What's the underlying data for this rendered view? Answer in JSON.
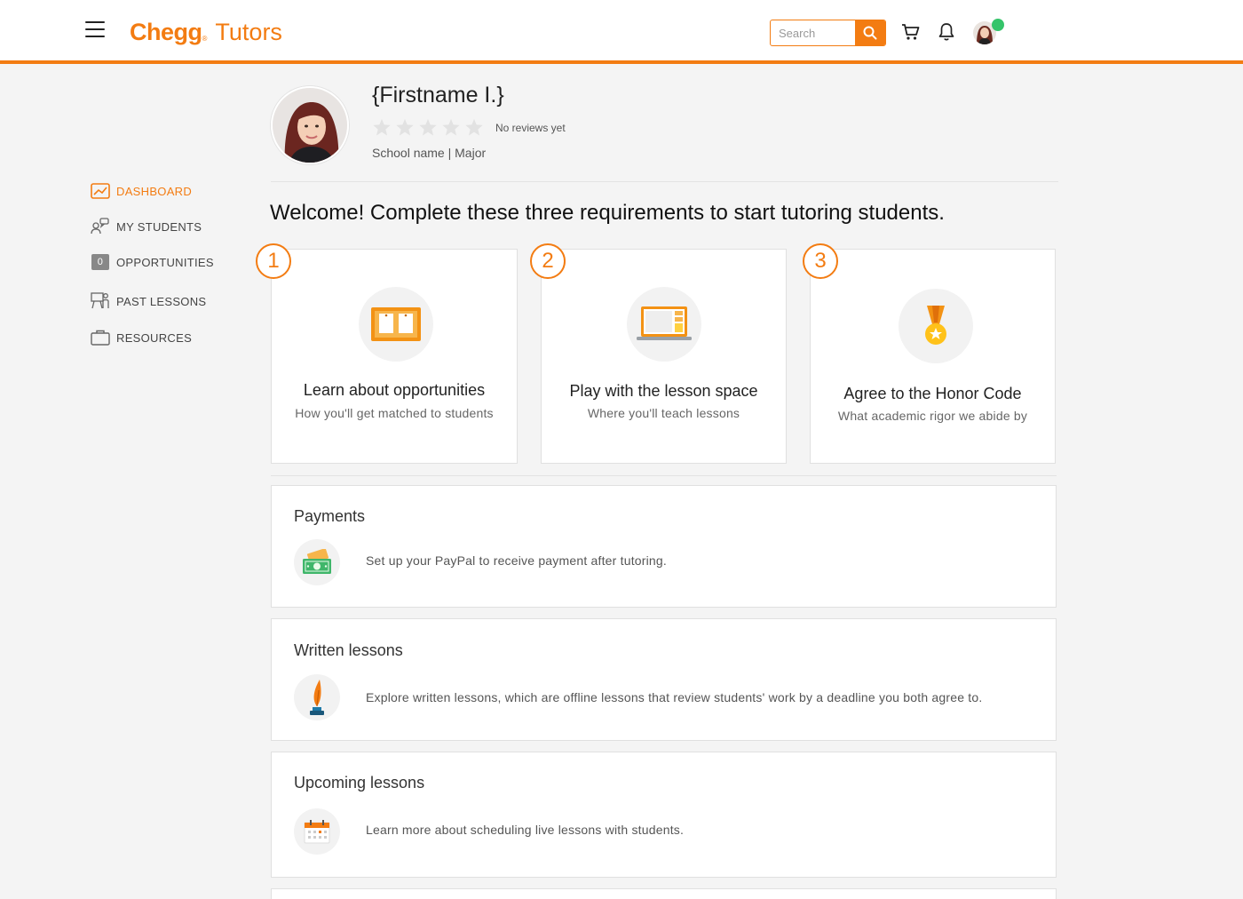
{
  "header": {
    "logo_brand": "Chegg",
    "logo_tm": "®",
    "logo_product": " Tutors",
    "search_placeholder": "Search",
    "accent_color": "#f37c12",
    "online_status_color": "#35c46a"
  },
  "sidebar": {
    "items": [
      {
        "label": "DASHBOARD",
        "icon": "chart-icon",
        "active": true
      },
      {
        "label": "MY STUDENTS",
        "icon": "students-icon"
      },
      {
        "label": "OPPORTUNITIES",
        "icon": "count-badge",
        "badge": "0"
      },
      {
        "label": "PAST LESSONS",
        "icon": "lessons-icon"
      },
      {
        "label": "RESOURCES",
        "icon": "briefcase-icon"
      }
    ]
  },
  "profile": {
    "name": "{Firstname I.}",
    "rating_stars": 0,
    "reviews": "No reviews yet",
    "school": "School name | Major"
  },
  "welcome": "Welcome! Complete these three requirements to start tutoring students.",
  "requirements": [
    {
      "number": "1",
      "title": "Learn about opportunities",
      "subtitle": "How you'll get matched to students",
      "icon": "corkboard-icon"
    },
    {
      "number": "2",
      "title": "Play with the lesson space",
      "subtitle": "Where you'll teach lessons",
      "icon": "laptop-icon"
    },
    {
      "number": "3",
      "title": "Agree to the Honor Code",
      "subtitle": "What academic rigor we abide by",
      "icon": "medal-icon"
    }
  ],
  "cards": [
    {
      "title": "Payments",
      "text": "Set up your PayPal to receive payment after tutoring.",
      "icon": "money-icon"
    },
    {
      "title": "Written lessons",
      "text": "Explore written lessons, which are offline lessons that review students' work by a deadline you both agree to.",
      "icon": "quill-icon"
    },
    {
      "title": "Upcoming lessons",
      "text": "Learn more about scheduling live lessons with students.",
      "icon": "calendar-icon"
    }
  ]
}
